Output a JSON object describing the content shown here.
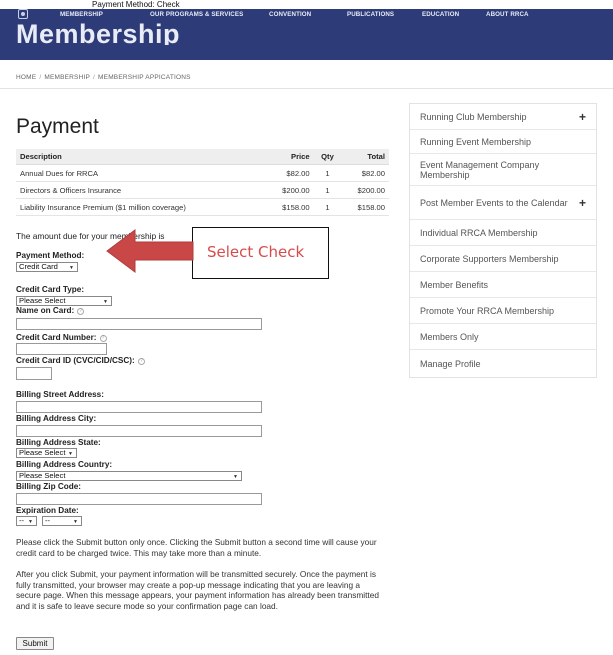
{
  "caption": "Payment Method: Check",
  "nav": {
    "items": [
      "MEMBERSHIP",
      "OUR PROGRAMS & SERVICES",
      "CONVENTION",
      "PUBLICATIONS",
      "EDUCATION",
      "ABOUT RRCA"
    ]
  },
  "banner": {
    "title": "Membership"
  },
  "breadcrumb": {
    "home": "HOME",
    "membership": "MEMBERSHIP",
    "current": "MEMBERSHIP APPICATIONS",
    "sep": "/"
  },
  "page_title": "Payment",
  "table": {
    "headers": {
      "description": "Description",
      "price": "Price",
      "qty": "Qty",
      "total": "Total"
    },
    "rows": [
      {
        "description": "Annual Dues for RRCA",
        "price": "$82.00",
        "qty": "1",
        "total": "$82.00"
      },
      {
        "description": "Directors & Officers Insurance",
        "price": "$200.00",
        "qty": "1",
        "total": "$200.00"
      },
      {
        "description": "Liability Insurance Premium ($1 million coverage)",
        "price": "$158.00",
        "qty": "1",
        "total": "$158.00"
      }
    ]
  },
  "amount_line": "The amount due for your membership is",
  "form": {
    "payment_method_label": "Payment Method:",
    "payment_method_value": "Credit Card",
    "card_type_label": "Credit Card Type:",
    "card_type_value": "Please Select",
    "name_label": "Name on Card:",
    "card_number_label": "Credit Card Number:",
    "card_id_label": "Credit Card ID (CVC/CID/CSC):",
    "street_label": "Billing Street Address:",
    "city_label": "Billing Address City:",
    "state_label": "Billing Address State:",
    "state_value": "Please Select",
    "country_label": "Billing Address Country:",
    "country_value": "Please Select",
    "zip_label": "Billing Zip Code:",
    "expiration_label": "Expiration Date:",
    "exp_month_value": "--",
    "exp_year_value": "--",
    "help_glyph": "?"
  },
  "notes": {
    "submit_once": "Please click the Submit button only once. Clicking the Submit button a second time will cause your credit card to be charged twice. This may take more than a minute.",
    "after_submit": "After you click Submit, your payment information will be transmitted securely. Once the payment is fully transmitted, your browser may create a pop-up message indicating that you are leaving a secure page. When this message appears, your payment information has already been transmitted and it is safe to leave secure mode so your confirmation page can load."
  },
  "submit_label": "Submit",
  "callout": {
    "text": "Select Check"
  },
  "colors": {
    "nav_bg": "#2d3b78",
    "callout_text": "#d94a4a",
    "arrow": "#c94747"
  },
  "sidebar": {
    "items": [
      {
        "label": "Running Club Membership",
        "plus": "+"
      },
      {
        "label": "Running Event Membership"
      },
      {
        "label": "Event Management Company Membership"
      },
      {
        "label": "Post Member Events to the Calendar",
        "plus": "+"
      },
      {
        "label": "Individual RRCA Membership"
      },
      {
        "label": "Corporate Supporters Membership"
      },
      {
        "label": "Member Benefits"
      },
      {
        "label": "Promote Your RRCA Membership"
      },
      {
        "label": "Members Only"
      },
      {
        "label": "Manage Profile"
      }
    ]
  }
}
